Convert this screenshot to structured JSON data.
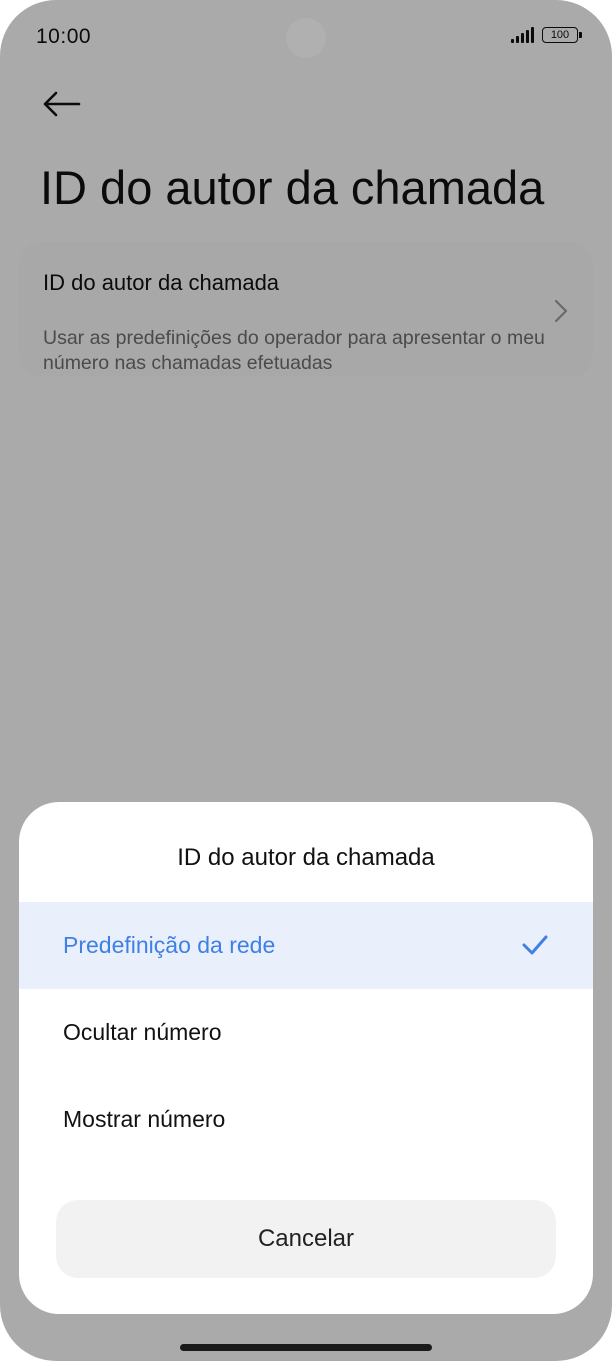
{
  "status_bar": {
    "time": "10:00",
    "battery_level": "100",
    "icons": [
      "signal-icon",
      "battery-icon"
    ]
  },
  "header": {
    "back_icon": "arrow-left-icon",
    "title": "ID do autor da chamada"
  },
  "settings_card": {
    "title": "ID do autor da chamada",
    "description": "Usar as predefinições do operador para apresentar o meu número nas chamadas efetuadas",
    "chevron_icon": "chevron-right-icon"
  },
  "dialog": {
    "title": "ID do autor da chamada",
    "options": [
      {
        "label": "Predefinição da rede",
        "selected": true
      },
      {
        "label": "Ocultar número",
        "selected": false
      },
      {
        "label": "Mostrar número",
        "selected": false
      }
    ],
    "cancel_label": "Cancelar"
  },
  "colors": {
    "accent": "#3f7fe6",
    "selected_row_bg": "#e9f0fc",
    "scrim": "rgba(0,0,0,0.31)"
  }
}
